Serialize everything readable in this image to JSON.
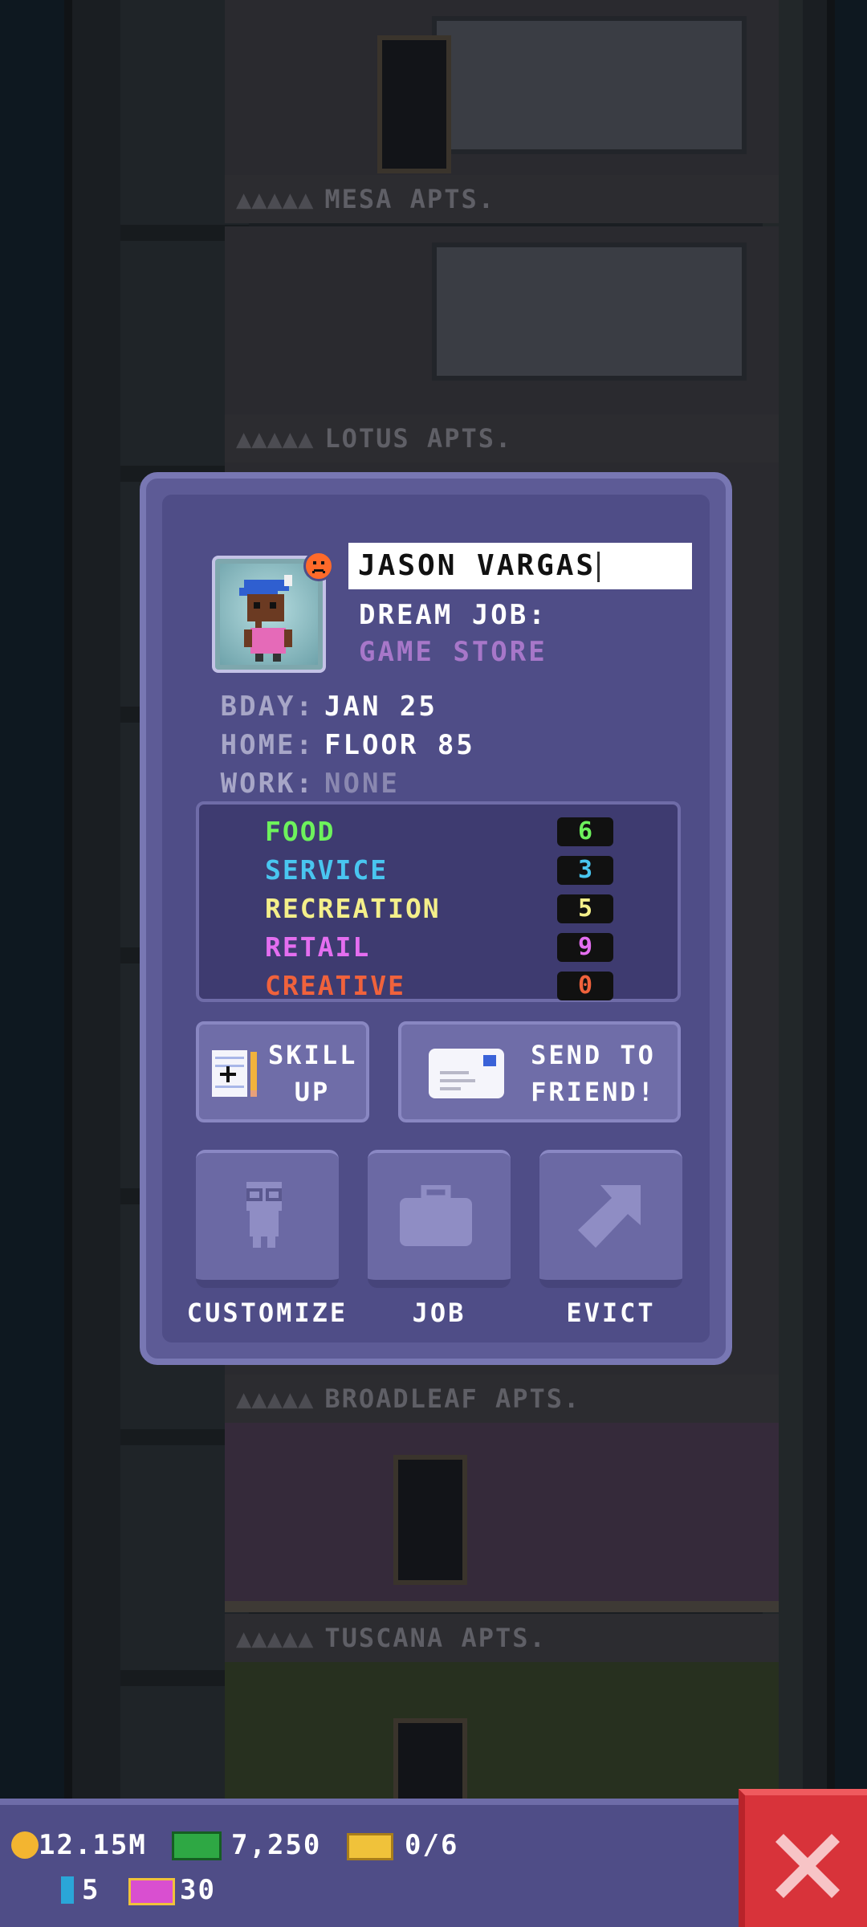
{
  "background": {
    "floors": [
      {
        "label": "MESA APTS."
      },
      {
        "label": "LOTUS APTS."
      },
      {
        "label": "BROADLEAF APTS."
      },
      {
        "label": "TUSCANA APTS."
      }
    ]
  },
  "profile": {
    "name": "JASON VARGAS",
    "dream_job_label": "DREAM JOB:",
    "dream_job_value": "GAME STORE",
    "bday_label": "BDAY:",
    "bday_value": "JAN 25",
    "home_label": "HOME:",
    "home_value": "FLOOR 85",
    "work_label": "WORK:",
    "work_value": "NONE",
    "mood": "unhappy"
  },
  "skills": [
    {
      "name": "FOOD",
      "value": "6",
      "color": "#6df25c"
    },
    {
      "name": "SERVICE",
      "value": "3",
      "color": "#49c6f0"
    },
    {
      "name": "RECREATION",
      "value": "5",
      "color": "#f4ef8a"
    },
    {
      "name": "RETAIL",
      "value": "9",
      "color": "#e46ef0"
    },
    {
      "name": "CREATIVE",
      "value": "0",
      "color": "#f0623c"
    }
  ],
  "actions": {
    "skill_up_line1": "SKILL",
    "skill_up_line2": "UP",
    "send_line1": "SEND TO",
    "send_line2": "FRIEND!",
    "customize": "CUSTOMIZE",
    "job": "JOB",
    "evict": "EVICT"
  },
  "hud": {
    "coins": "12.15M",
    "bux": "7,250",
    "tickets": "0/6",
    "keys": "5",
    "golden_tickets": "30"
  },
  "icons": {
    "skill_up": "notepad-pencil-icon",
    "send": "envelope-icon",
    "customize": "person-glasses-icon",
    "job": "briefcase-icon",
    "evict": "arrow-up-right-icon",
    "close": "close-x-icon"
  }
}
